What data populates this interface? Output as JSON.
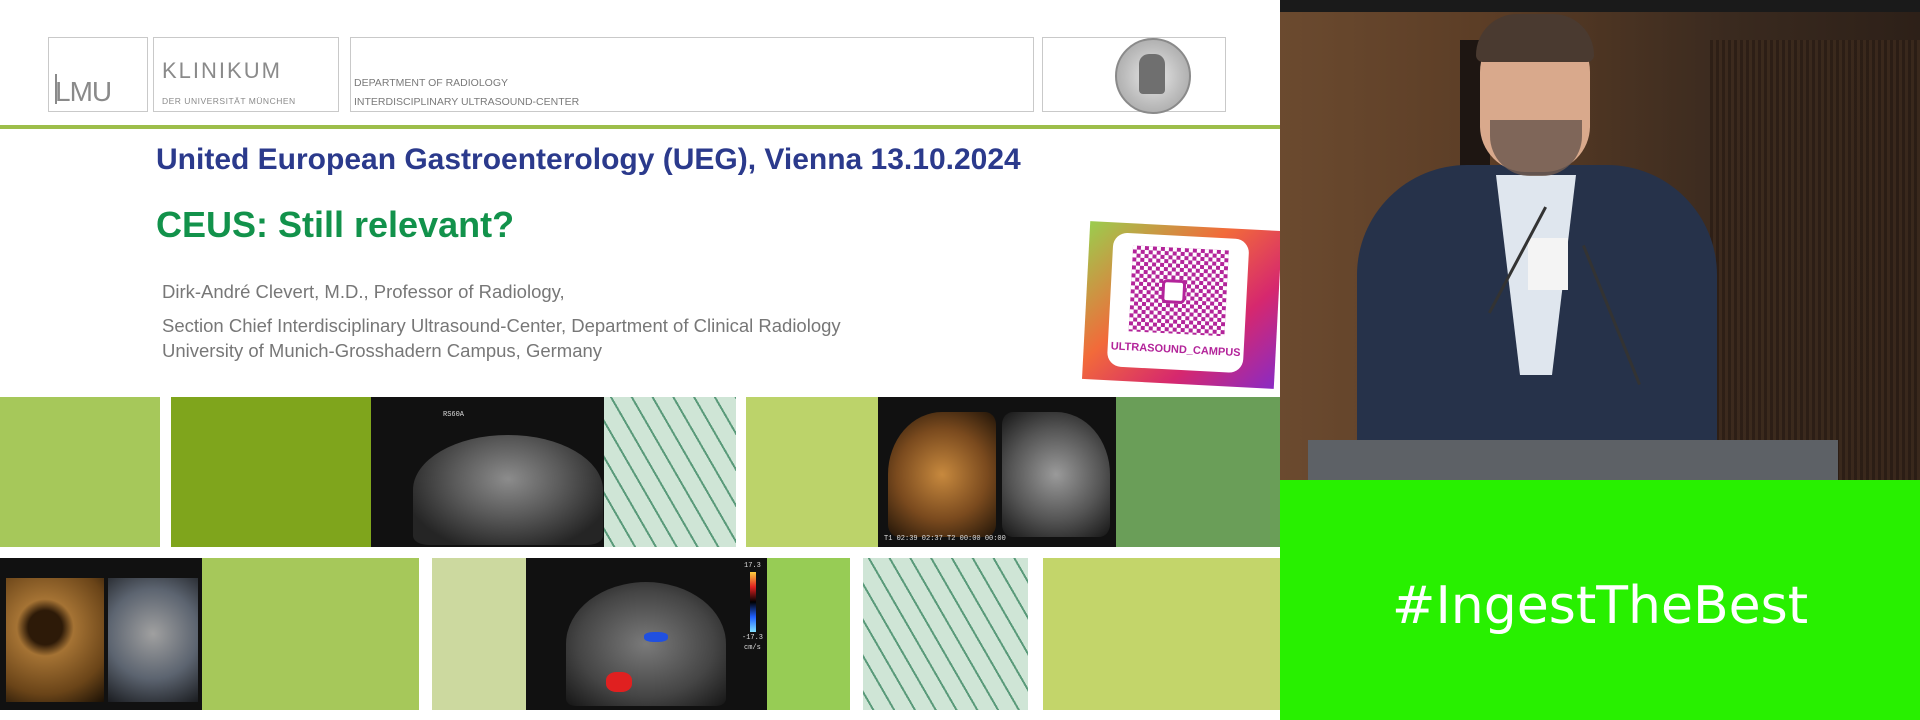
{
  "header": {
    "lmu_logo": "LMU",
    "klinikum_title": "KLINIKUM",
    "klinikum_subtitle": "DER UNIVERSITÄT MÜNCHEN",
    "department_line1": "DEPARTMENT OF RADIOLOGY",
    "department_line2": "INTERDISCIPLINARY ULTRASOUND-CENTER"
  },
  "slide": {
    "event_title": "United European Gastroenterology (UEG), Vienna 13.10.2024",
    "talk_title": "CEUS: Still relevant?",
    "author_line1": "Dirk-André Clevert, M.D., Professor of Radiology,",
    "author_line2": "Section Chief Interdisciplinary Ultrasound-Center, Department of Clinical Radiology",
    "author_line3": "University of Munich-Grosshadern Campus, Germany"
  },
  "instagram_card": {
    "handle": "ULTRASOUND_CAMPUS"
  },
  "ultrasound_labels": {
    "img1_top": "RS60A",
    "img2_bottom": "T1 02:39 02:37  T2 00:00 00:00",
    "img4_scale_top": "17.3",
    "img4_scale_bottom": "-17.3",
    "img4_unit": "cm/s"
  },
  "banner": {
    "hashtag": "#IngestTheBest"
  },
  "colors": {
    "event_title": "#2b3a8c",
    "talk_title": "#12924b",
    "banner_green": "#28f000",
    "accent_line": "#9dbe4a"
  }
}
